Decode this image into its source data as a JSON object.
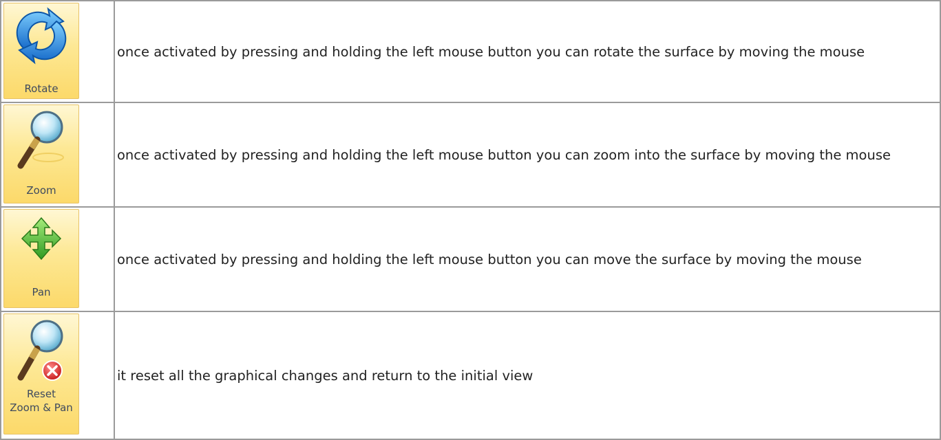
{
  "rows": [
    {
      "button_label": "Rotate",
      "icon": "rotate-icon",
      "description": "once activated by pressing and holding the left mouse button you can rotate the surface by moving the mouse"
    },
    {
      "button_label": "Zoom",
      "icon": "magnifier-icon",
      "description": "once activated by pressing and holding the left mouse button you can zoom into the surface by moving the mouse"
    },
    {
      "button_label": "Pan",
      "icon": "move-arrows-icon",
      "description": "once activated by pressing and holding the left mouse button you can move the surface by moving the mouse"
    },
    {
      "button_label_line1": "Reset",
      "button_label_line2": "Zoom & Pan",
      "icon": "magnifier-reset-icon",
      "description": "it reset all the graphical changes and return to the initial view"
    }
  ],
  "colors": {
    "button_bg": "#fde894",
    "button_border": "#e7c267",
    "label_text": "#3e4a5e",
    "cell_border": "#9a9a9a"
  }
}
